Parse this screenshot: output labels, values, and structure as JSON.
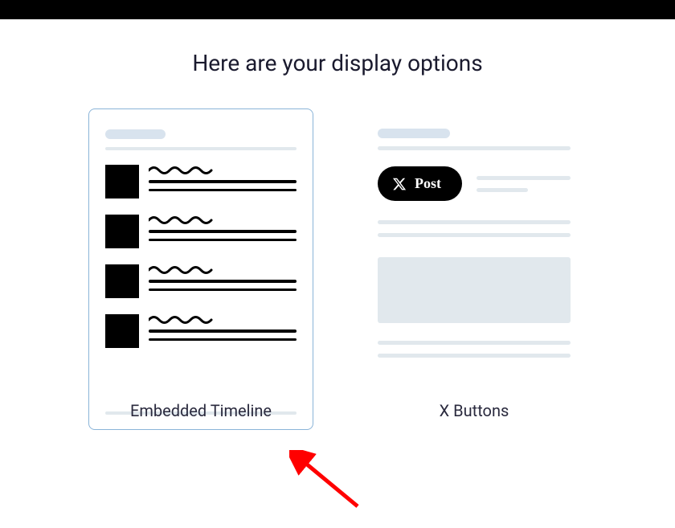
{
  "heading": "Here are your display options",
  "options": {
    "timeline": {
      "label": "Embedded Timeline"
    },
    "buttons": {
      "label": "X Buttons",
      "post_button_text": "Post"
    }
  }
}
